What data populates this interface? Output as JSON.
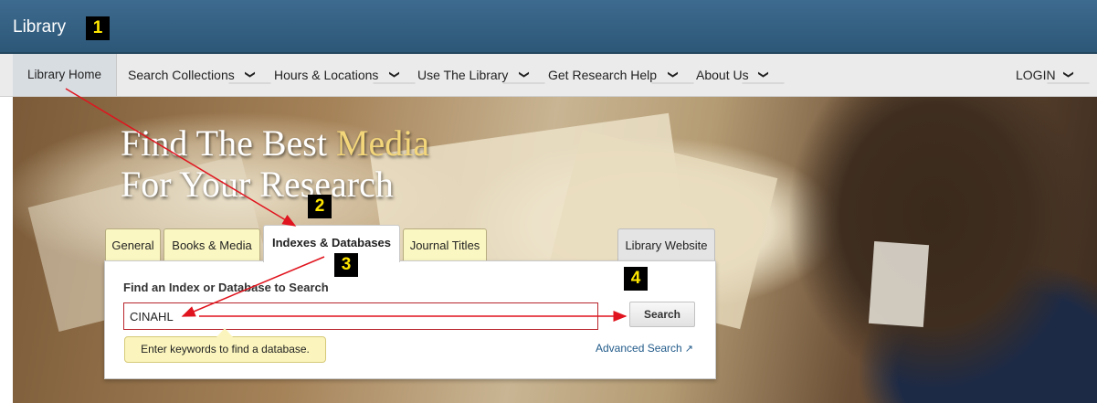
{
  "header": {
    "title": "Library",
    "badge": "1"
  },
  "nav": {
    "items": [
      {
        "label": "Library Home"
      },
      {
        "label": "Search Collections"
      },
      {
        "label": "Hours & Locations"
      },
      {
        "label": "Use The Library"
      },
      {
        "label": "Get Research Help"
      },
      {
        "label": "About Us"
      }
    ],
    "login": "LOGIN"
  },
  "hero": {
    "title_part1": "Find The Best ",
    "title_accent": "Media",
    "title_line2": "For Your Research"
  },
  "tabs": [
    {
      "label": "General"
    },
    {
      "label": "Books & Media"
    },
    {
      "label": "Indexes & Databases",
      "active": true
    },
    {
      "label": "Journal Titles"
    },
    {
      "label": "Library Website"
    }
  ],
  "search": {
    "label": "Find an Index or Database to Search",
    "value": "CINAHL",
    "button": "Search",
    "tooltip": "Enter keywords to find a database.",
    "advanced": "Advanced Search"
  },
  "annotations": {
    "badge2": "2",
    "badge3": "3",
    "badge4": "4",
    "arrow_color": "#e0141e"
  },
  "colors": {
    "header_bg": "#2d5777",
    "tab_bg": "#fbf7c2",
    "badge_bg": "#000000",
    "badge_fg": "#ffe600"
  }
}
